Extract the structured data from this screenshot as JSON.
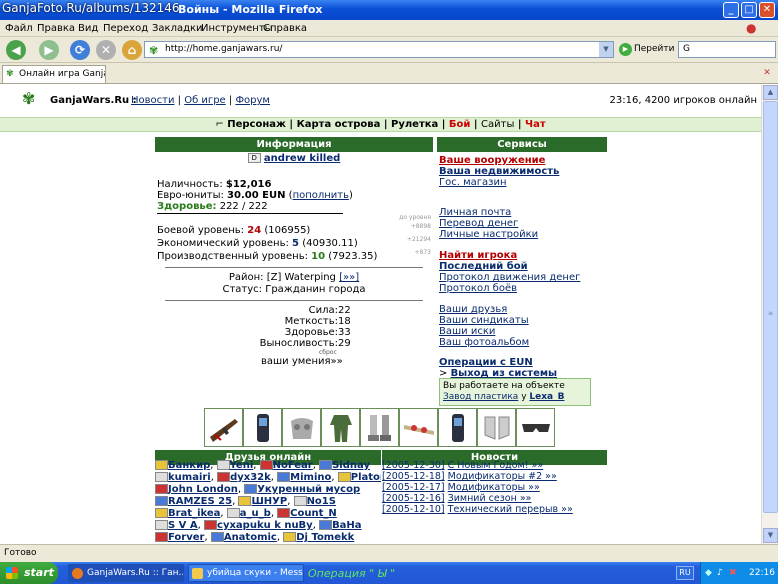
{
  "watermark": "GanjaFoto.Ru/albums/132146",
  "window": {
    "title": "Войны - Mozilla Firefox"
  },
  "menu": [
    "Файл",
    "Правка",
    "Вид",
    "Переход",
    "Закладки",
    "Инструменты",
    "Справка"
  ],
  "address": {
    "url": "http://home.ganjawars.ru/",
    "go_label": "Перейти"
  },
  "tab": {
    "label": "Онлайн игра Ganja..."
  },
  "site": {
    "brand": "GanjaWars.Ru :",
    "links": [
      "Новости",
      "Об игре",
      "Форум"
    ],
    "time": "23:16, 4200 игроков онлайн",
    "nav": [
      "Персонаж",
      "Карта острова",
      "Рулетка",
      "Бой",
      "Сайты",
      "Чат"
    ]
  },
  "info": {
    "header": "Информация",
    "player": "andrew killed",
    "cash_label": "Наличность:",
    "cash": "$12,016",
    "euro_label": "Евро-юниты:",
    "euro": "30.00 EUN",
    "euro_link": "пополнить",
    "health_label": "Здоровье:",
    "health": "222 / 222",
    "to_level": "до уровня",
    "levels": [
      {
        "label": "Боевой уровень:",
        "value": "24",
        "exp": "(106955)",
        "delta": "+8898",
        "color": "#b40000"
      },
      {
        "label": "Экономический уровень:",
        "value": "5",
        "exp": "(40930.11)",
        "delta": "+21294",
        "color": "#0a2b6e"
      },
      {
        "label": "Производственный уровень:",
        "value": "10",
        "exp": "(7923.35)",
        "delta": "+873",
        "color": "#2a7a1a"
      }
    ],
    "district_label": "Район:",
    "district": "[Z] Waterping",
    "district_link": "[»»]",
    "status_label": "Статус:",
    "status": "Гражданин города",
    "stats": [
      {
        "label": "Сила:",
        "value": "22"
      },
      {
        "label": "Меткость:",
        "value": "18"
      },
      {
        "label": "Здоровье:",
        "value": "33"
      },
      {
        "label": "Выносливость:",
        "value": "29"
      }
    ],
    "reset": "сброс",
    "skills": "ваши умения»»"
  },
  "services": {
    "header": "Сервисы",
    "group1": [
      "Ваше вооружение",
      "Ваша недвижимость",
      "Гос. магазин"
    ],
    "group2": [
      "Личная почта",
      "Перевод денег",
      "Личные настройки"
    ],
    "group3": [
      "Найти игрока",
      "Последний бой",
      "Протокол движения денег",
      "Протокол боёв"
    ],
    "group4": [
      "Ваши друзья",
      "Ваши синдикаты",
      "Ваши иски",
      "Ваш фотоальбом"
    ],
    "eun_ops": "Операции с EUN",
    "exit": "Выход из системы"
  },
  "work_note": {
    "text": "Вы работаете на объекте",
    "place": "Завод пластика",
    "by": "у",
    "owner": "Lexa_B"
  },
  "items": [
    "rifle",
    "phone",
    "armor",
    "camo",
    "boots",
    "grenade-belt",
    "phone",
    "pads",
    "goggles"
  ],
  "friends": {
    "header": "Друзья онлайн",
    "rows": [
      [
        "Банкир",
        "Yeni",
        "NoFear",
        "Sidnay"
      ],
      [
        "kumairi",
        "dyx32k",
        "Mimino",
        "Platon"
      ],
      [
        "John London",
        "Укуренный мусор"
      ],
      [
        "RAMZES 25",
        "ШНУР",
        "No1S"
      ],
      [
        "Brat_ikea",
        "a_u_b",
        "Count_N"
      ],
      [
        "S V A",
        "сухарuku k nuBy",
        "BaHa"
      ],
      [
        "Forver",
        "Anatomic",
        "Dj Tomekk"
      ]
    ]
  },
  "news": {
    "header": "Новости",
    "items": [
      {
        "date": "[2005-12-30]",
        "title": "С Новым Годом! »»"
      },
      {
        "date": "[2005-12-18]",
        "title": "Модификаторы #2 »»"
      },
      {
        "date": "[2005-12-17]",
        "title": "Модификаторы »»"
      },
      {
        "date": "[2005-12-16]",
        "title": "Зимний сезон »»"
      },
      {
        "date": "[2005-12-10]",
        "title": "Технический перерыв »»"
      }
    ]
  },
  "status": "Готово",
  "taskbar": {
    "start": "start",
    "tasks": [
      "GanjaWars.Ru :: Ган...",
      "убийца скуки - Messa..."
    ],
    "operation": "Операция \" Ы \"",
    "lang": "RU",
    "clock": "22:16"
  }
}
